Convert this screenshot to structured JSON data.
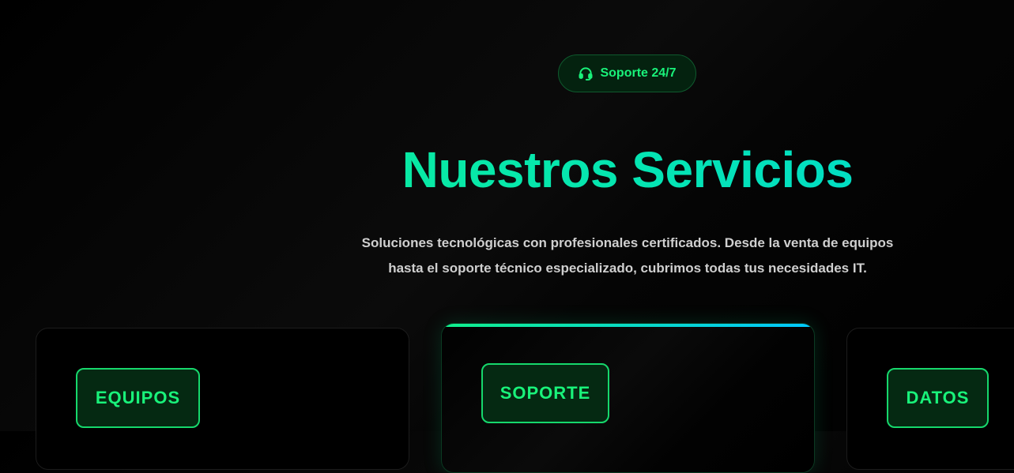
{
  "badge": {
    "icon": "headset-icon",
    "label": "Soporte 24/7"
  },
  "heading": {
    "title": "Nuestros Servicios",
    "subtitle_line1": "Soluciones tecnológicas con profesionales certificados. Desde la venta de equipos",
    "subtitle_line2": "hasta el soporte técnico especializado, cubrimos todas tus necesidades IT."
  },
  "cards": [
    {
      "label": "EQUIPOS"
    },
    {
      "label": "SOPORTE"
    },
    {
      "label": "DATOS"
    }
  ],
  "colors": {
    "background": "#000000",
    "accent_green": "#19f27a",
    "accent_teal": "#00d8cf",
    "chip_background": "#052912",
    "text_muted": "#cfcfcf"
  }
}
